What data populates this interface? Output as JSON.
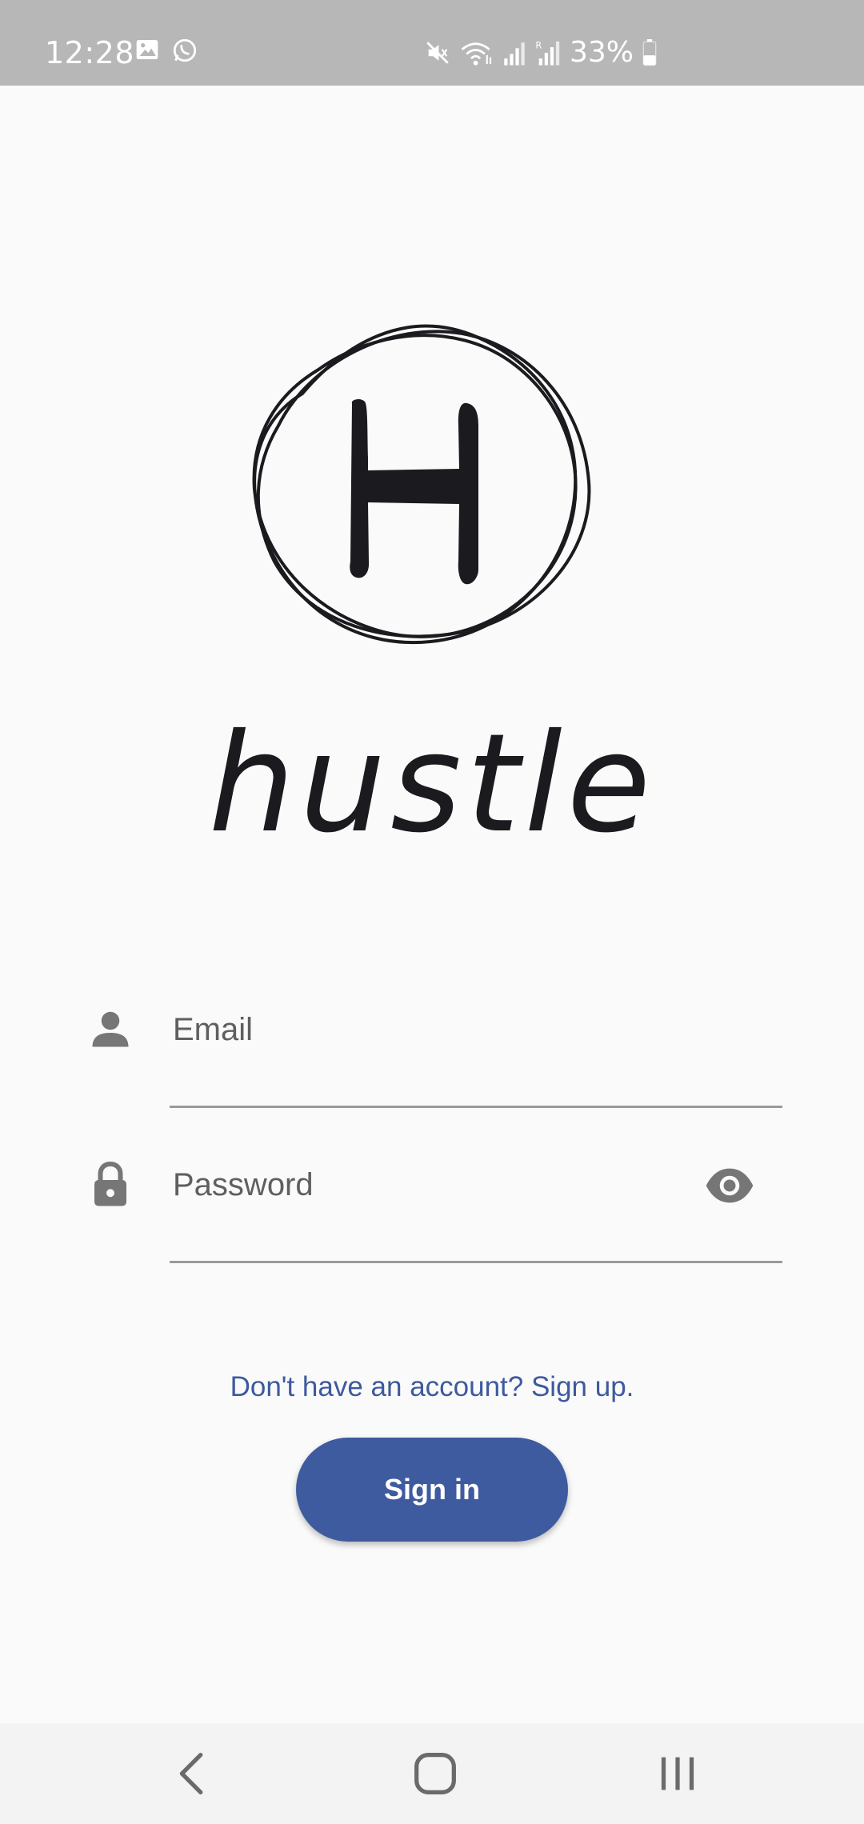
{
  "status_bar": {
    "time": "12:28",
    "battery": "33%",
    "left_icons": [
      "gallery-icon",
      "whatsapp-icon"
    ],
    "right_icons": [
      "mute-icon",
      "wifi-icon",
      "signal-icon",
      "roaming-signal-icon",
      "battery-icon"
    ],
    "background": "#b7b7b7"
  },
  "logo": {
    "letter": "H",
    "app_name": "hustle"
  },
  "form": {
    "email_placeholder": "Email",
    "password_placeholder": "Password",
    "show_password_icon": "eye-icon"
  },
  "signup_link": "Don't have an account? Sign up.",
  "signin_button": "Sign in",
  "nav_bar": {
    "back_icon": "back-icon",
    "home_icon": "home-icon",
    "recents_icon": "recents-icon"
  },
  "colors": {
    "accent": "#3f5b9f",
    "link": "#3d5a9e",
    "background": "#fafafa"
  }
}
